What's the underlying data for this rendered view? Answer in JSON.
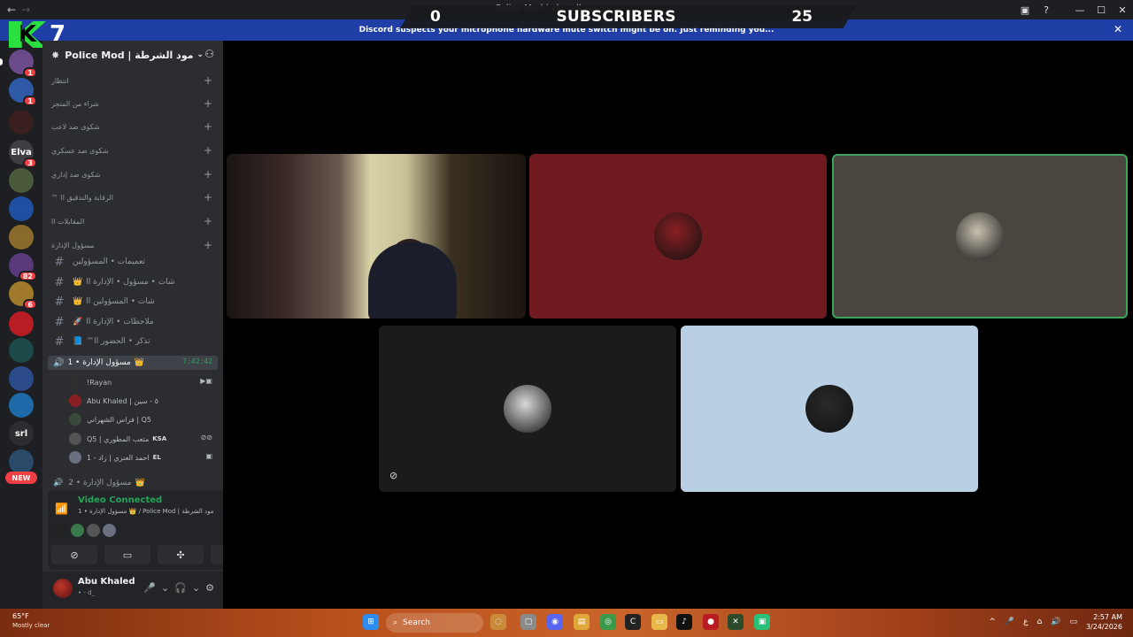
{
  "window": {
    "title": "Police Mod | مود الشرطة"
  },
  "overlay": {
    "left_count": "0",
    "label": "SUBSCRIBERS",
    "right_count": "25",
    "logo_letter": "K",
    "logo_number": "7"
  },
  "notice": {
    "text": "Discord suspects your microphone hardware mute switch might be on. Just reminding you..."
  },
  "server_list": {
    "items": [
      {
        "name": "server-1",
        "badge": "1",
        "color": "#6b4a8a"
      },
      {
        "name": "server-2",
        "badge": "1",
        "color": "#2e5aa8"
      },
      {
        "name": "server-3",
        "badge": "",
        "color": "#3a1f1f"
      },
      {
        "name": "server-4",
        "badge": "3",
        "label": "Elva",
        "color": "#3d3f45"
      },
      {
        "name": "server-5",
        "badge": "",
        "color": "#4a5a3a"
      },
      {
        "name": "server-6",
        "badge": "",
        "color": "#1e4fa0"
      },
      {
        "name": "server-7",
        "badge": "",
        "color": "#8a6a2a"
      },
      {
        "name": "server-8",
        "badge": "82",
        "color": "#5a3a7a"
      },
      {
        "name": "server-9",
        "badge": "6",
        "color": "#a07a2a"
      },
      {
        "name": "server-10",
        "badge": "",
        "color": "#b81d24"
      },
      {
        "name": "server-11",
        "badge": "",
        "color": "#1e4a4a"
      },
      {
        "name": "server-12",
        "badge": "",
        "color": "#2a4a8a"
      },
      {
        "name": "server-13",
        "badge": "",
        "color": "#1e6aa8"
      },
      {
        "name": "server-14",
        "badge": "",
        "label": "srl",
        "color": "#2b2d31"
      },
      {
        "name": "server-15",
        "badge": "",
        "color": "#2a4a6a"
      }
    ],
    "new_label": "NEW"
  },
  "sidebar": {
    "server_name": "Police Mod | مود الشرطة",
    "categories": [
      "انتظار",
      "شراء من المتجر",
      "شكوى ضد لاعب",
      "شكوى ضد عسكري",
      "شكوى ضد إداري",
      "™ الرقابة والتدقيق اا",
      "المقابلات اا",
      "مسؤول الإدارة"
    ],
    "channels": [
      {
        "emoji": "",
        "label": "تعميمات • المسؤولين"
      },
      {
        "emoji": "👑",
        "label": "شات • مسؤول • الإدارة اا"
      },
      {
        "emoji": "👑",
        "label": "شات • المسؤولين اا"
      },
      {
        "emoji": "🚀",
        "label": "ملاحظات • الإدارة اا"
      },
      {
        "emoji": "📘",
        "label": "™تذكر • الحضور اا"
      }
    ],
    "voice_channel": {
      "label": "مسؤول الإدارة • 1",
      "timer": "7:42:42"
    },
    "members": [
      {
        "name": "!Rayan",
        "tag": "",
        "color": "#2f2f2f"
      },
      {
        "name": "Abu Khaled | ٥ - سين",
        "tag": "",
        "color": "#8a1f22"
      },
      {
        "name": "فراس الشهراني | Q5",
        "tag": "",
        "color": "#3a4a3a"
      },
      {
        "name": "Q5 | متعب المطوري",
        "tag": "KSA",
        "color": "#555"
      },
      {
        "name": "احمد العنزي | زاد - 1",
        "tag": "EL",
        "color": "#6a7080"
      }
    ],
    "voice_channel_2": {
      "label": "مسؤول الإدارة • 2"
    }
  },
  "voice_panel": {
    "status": "Video Connected",
    "subtitle": "مسؤول الإدارة • 1 👑 / Police Mod | مود الشرطة"
  },
  "user": {
    "name": "Abu Khaled",
    "status": "• - d_"
  },
  "tiles": [
    {
      "name": "streamer-camera",
      "bg": "#000000"
    },
    {
      "name": "tile-red-user",
      "bg": "#6e1a1e",
      "avatar": "#8a1f22"
    },
    {
      "name": "tile-olive-user",
      "bg": "#4a453e",
      "avatar": "#c8c0b0",
      "border": "#3ba55c"
    },
    {
      "name": "tile-dark-user",
      "bg": "#1b1b1b",
      "avatar": "#d8d8d8"
    },
    {
      "name": "tile-light-user",
      "bg": "#b8cfe4",
      "avatar": "#2a2a2a"
    }
  ],
  "taskbar": {
    "temperature": "65°F",
    "weather": "Mostly clear",
    "search_placeholder": "Search",
    "time": "2:57 AM",
    "date": "3/24/2026",
    "lang": "ع"
  }
}
